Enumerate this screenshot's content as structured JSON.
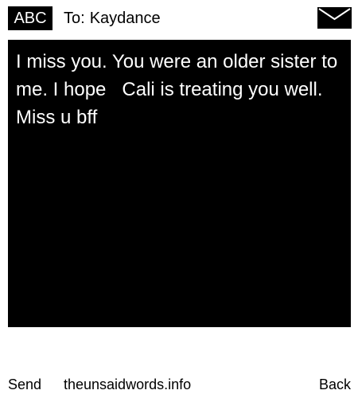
{
  "header": {
    "input_mode": "ABC",
    "to_label": "To:",
    "recipient": "Kaydance",
    "mail_icon": "envelope-icon"
  },
  "message": {
    "text": "I miss you. You were an older sister to me. I hope   Cali is treating you well. Miss u bff"
  },
  "footer": {
    "send_label": "Send",
    "site_label": "theunsaidwords.info",
    "back_label": "Back"
  },
  "colors": {
    "background": "#ffffff",
    "message_background": "#000000",
    "message_text": "#ffffff",
    "text": "#000000"
  }
}
